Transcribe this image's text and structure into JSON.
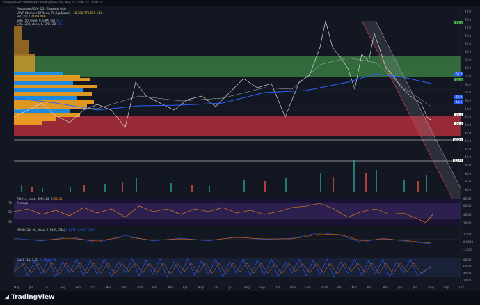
{
  "top_bar": {
    "text": "savepigment created with TradingView.com, Aug 12, 2026 10:13 UTC-2"
  },
  "main_legend": {
    "line1": "Photocore ADA · 1D · Euronext Oslo",
    "line2": "VRVP (Number Of Rows, 70, Up/Down)",
    "line2_values": "+18.38K  776.65K  1.10",
    "line3": "Vol (20)",
    "line3_values": "7.2K  69.47K",
    "line4": "SMA (50, close, 0, SMA, 50)",
    "line4_value": "57.2",
    "line5": "SMA (200, close, 0, SMA, 20)",
    "line5_value": "55.1"
  },
  "price_axis": [
    "78.0",
    "76.0",
    "74.0",
    "72.0",
    "70.0",
    "68.0",
    "66.0",
    "64.0",
    "62.0",
    "60.0",
    "58.0",
    "56.0",
    "54.0",
    "52.0",
    "50.0",
    "48.0",
    "46.0",
    "44.0",
    "42.0",
    "40.0",
    "38.0",
    "36.0",
    "34.0"
  ],
  "price_tags": [
    {
      "text": "76.3",
      "color": "#4caf50"
    },
    {
      "text": "62.7",
      "color": "#2962ff"
    },
    {
      "text": "61.4",
      "color": "#4caf50"
    },
    {
      "text": "57.2",
      "color": "#2962ff"
    },
    {
      "text": "55.1",
      "color": "#2962ff"
    },
    {
      "text": "52.4",
      "color": "#ffffff"
    },
    {
      "text": "50.4",
      "color": "#ffffff"
    },
    {
      "text": "46.29",
      "color": "#ffffff"
    },
    {
      "text": "40.70",
      "color": "#ffffff"
    }
  ],
  "rsi": {
    "label": "RSI (14, close, SMA, 14, 2)",
    "value": "31.51",
    "sub_label": "Average",
    "axis": [
      "80.00",
      "60.00",
      "40.00",
      "20.00"
    ],
    "left_marks": [
      "70",
      "50",
      "30"
    ]
  },
  "macd": {
    "label": "MACD (12, 26, close, 9, EMA, EMA)",
    "values": "0.0274  -1.869  -1.897",
    "axis": [
      "2.500",
      "0.0000",
      "-2.500"
    ]
  },
  "stoch": {
    "label": "Stoch (14, 3, 3)",
    "values": "33.25  32.96",
    "axis": [
      "80.00",
      "60.00",
      "40.00",
      "20.00"
    ]
  },
  "time_axis": [
    "May",
    "Jun",
    "Jul",
    "Aug",
    "Sep",
    "Oct",
    "Nov",
    "Dec",
    "2025",
    "Feb",
    "Mar",
    "Apr",
    "May",
    "Jun",
    "Jul",
    "Aug",
    "Sep",
    "Oct",
    "Nov",
    "Dec",
    "2026",
    "Feb",
    "Mar",
    "Apr",
    "May",
    "Jun",
    "Jul",
    "Aug",
    "Sep",
    "Oct"
  ],
  "brand": "TradingView",
  "colors": {
    "green_zone": "#4caf50",
    "red_zone": "#f23645",
    "sma_blue": "#2962ff",
    "volume_profile_orange": "#f5a623",
    "volume_profile_blue": "#2196f3"
  }
}
